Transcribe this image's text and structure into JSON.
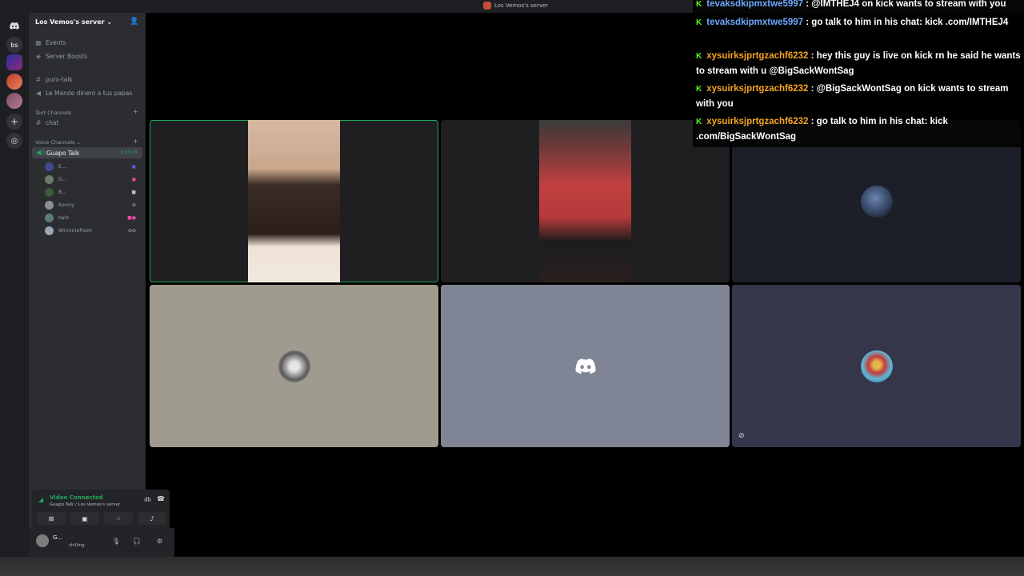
{
  "window": {
    "title": "Los Vemos's server"
  },
  "servers": {
    "label_bs": "bs"
  },
  "sidebar": {
    "server_name": "Los Vemos's server ⌄",
    "items": [
      {
        "label": "Events",
        "icon": "calendar-icon"
      },
      {
        "label": "Server Boosts",
        "icon": "boost-icon"
      },
      {
        "label": "puro-talk",
        "icon": "hash-icon"
      },
      {
        "label": "Le Mande dinero a tus papas",
        "icon": "speaker-icon"
      }
    ],
    "text_category": "Text Channels",
    "text_channels": [
      {
        "label": "chat"
      }
    ],
    "voice_category": "Voice Channels ⌄",
    "active_voice": {
      "label": "Guapo Talk",
      "time": "3:23:16"
    },
    "voice_users": [
      {
        "name": "E...",
        "color": "#3f4a8a"
      },
      {
        "name": "G...",
        "color": "#6b7a6a"
      },
      {
        "name": "B...",
        "color": "#3d5a3a"
      },
      {
        "name": "Kenny",
        "color": "#8c8f93"
      },
      {
        "name": "twlz",
        "color": "#5e7c7c"
      },
      {
        "name": "WinnniePooh",
        "color": "#9aa7b5"
      }
    ]
  },
  "voice_panel": {
    "status": "Video Connected",
    "sub": "Guapo Talk / Los Vemos's server"
  },
  "user": {
    "name": "G...",
    "status": "chilling"
  },
  "colors": {
    "accent": "#23a55a",
    "kick": "#53fc18",
    "blurple": "#5865f2"
  },
  "tiles": [
    {
      "name": "video-tile-1",
      "bg": "#1f1f21"
    },
    {
      "name": "video-tile-2",
      "bg": "#1f1f21"
    },
    {
      "name": "avatar-tile-3",
      "bg": "#1c1f28"
    },
    {
      "name": "avatar-tile-4",
      "bg": "#9f9b8f"
    },
    {
      "name": "avatar-tile-5",
      "bg": "#7f8594"
    },
    {
      "name": "avatar-tile-6",
      "bg": "#353649"
    }
  ],
  "chat": {
    "messages": [
      {
        "user": "tevaksdkipmxtwe5997",
        "text": ": @IMTHEJ4 on kick wants to stream with you"
      },
      {
        "user": "tevaksdkipmxtwe5997",
        "text": ": go talk to him in his chat: kick .com/IMTHEJ4"
      },
      {
        "user": "xysuirksjprtgzachf6232",
        "text": ": hey this guy is live on kick rn he said he wants to stream with u @BigSackWontSag"
      },
      {
        "user": "xysuirksjprtgzachf6232",
        "text": ": @BigSackWontSag on kick wants to stream with you"
      },
      {
        "user": "xysuirksjprtgzachf6232",
        "text": ": go talk to him in his chat: kick .com/BigSackWontSag"
      }
    ]
  }
}
